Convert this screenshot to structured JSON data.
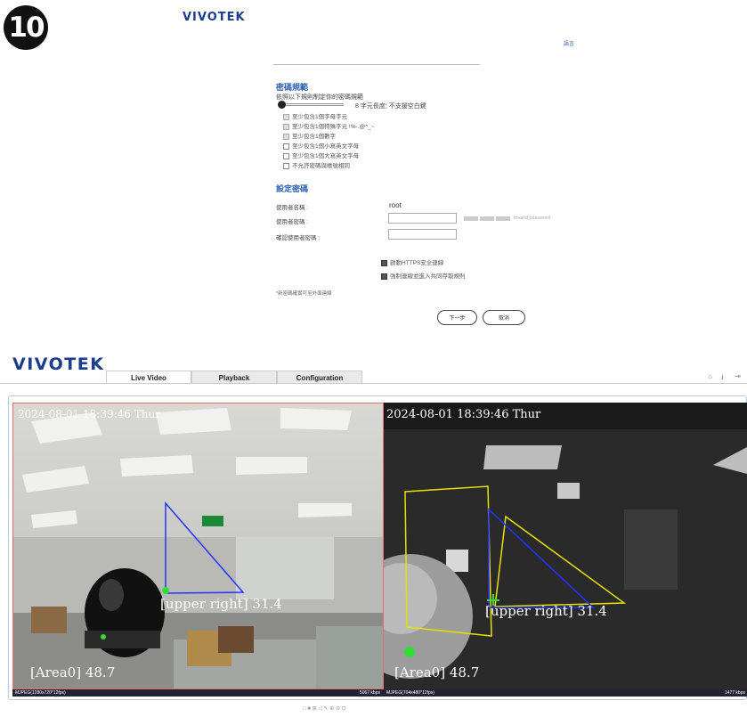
{
  "step_badge": "10",
  "setup": {
    "logo": "VIVOTEK",
    "language_link": "語言",
    "password_policy": {
      "title": "密碼規範",
      "intro": "依照以下規則制定你的密碼規範",
      "length_note": "8 字元長度; 不支援空白鍵",
      "rules": [
        {
          "label": "至少包含1個字母字元",
          "state": "disabled"
        },
        {
          "label": "至少包含1個特殊字元 !%-.@^_~",
          "state": "disabled"
        },
        {
          "label": "至少包含1個數字",
          "state": "disabled"
        },
        {
          "label": "至少包含1個小寫英文字母",
          "state": "unchecked"
        },
        {
          "label": "至少包含1個大寫英文字母",
          "state": "unchecked"
        },
        {
          "label": "不允許密碼與帳號相同",
          "state": "unchecked"
        }
      ]
    },
    "set_password": {
      "title": "設定密碼",
      "username_label": "使用者名稱 :",
      "username_value": "root",
      "password_label": "使用者密碼 :",
      "password_value": "",
      "strength_text": "Invalid password",
      "confirm_label": "確認使用者密碼 :",
      "confirm_value": ""
    },
    "options": [
      {
        "label": "啟動HTTPS安全連線",
        "checked": true
      },
      {
        "label": "強制連線並進入共同存取規則",
        "checked": true
      }
    ],
    "footnote": "*新密碼確實可至外面連線",
    "next_button": "下一步",
    "cancel_button": "取消"
  },
  "viewer": {
    "logo": "VIVOTEK",
    "tabs": [
      "Live Video",
      "Playback",
      "Configuration"
    ],
    "active_tab": "Live Video",
    "toolbar_icons": [
      "home-icon",
      "download-icon",
      "logout-icon"
    ],
    "left_stream": {
      "timestamp": "2024-08-01 18:39:46 Thur",
      "overlay_upper": "[upper right] 31.4",
      "overlay_area": "[Area0] 48.7",
      "format": "MJPEG(1280x720*12fps)",
      "bitrate": "5067 kbps"
    },
    "right_stream": {
      "timestamp": "2024-08-01 18:39:46 Thur",
      "overlay_upper": "[upper right] 31.4",
      "overlay_area": "[Area0] 48.7",
      "format": "MJPEG(704x480*12fps)",
      "bitrate": "1477 kbps"
    },
    "bottom_toolbar": "□ ■ ⊞ ◁ ✎ ⊕ ⊖ ⊡"
  },
  "colors": {
    "brand": "#1a3d8f",
    "link": "#2b5fb0",
    "roi_blue": "#2233ff",
    "roi_yellow": "#e8e000",
    "roi_marker": "#33dd33"
  }
}
